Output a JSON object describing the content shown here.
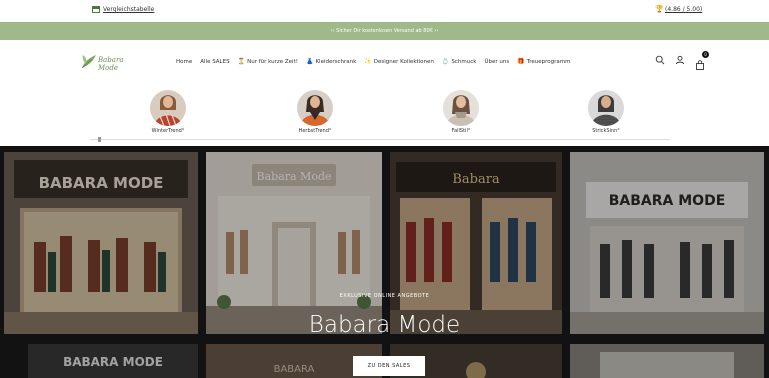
{
  "topbar": {
    "compare_label": "Vergleichstabelle",
    "rating": "(4.86 / 5.00)"
  },
  "banner": {
    "text": "›› Sicher Dir kostenlosen Versand ab 80€ ››"
  },
  "logo": {
    "text": "Babara Mode"
  },
  "nav": {
    "items": [
      {
        "label": "Home",
        "icon": ""
      },
      {
        "label": "Alle SALES",
        "icon": ""
      },
      {
        "label": "Nur für kurze Zeit!",
        "icon": "⏳"
      },
      {
        "label": "Kleiderschrank",
        "icon": "👗"
      },
      {
        "label": "Designer Kollektionen",
        "icon": "✨"
      },
      {
        "label": "Schmuck",
        "icon": "💍"
      },
      {
        "label": "Über uns",
        "icon": ""
      },
      {
        "label": "Treueprogramm",
        "icon": "🎁"
      }
    ],
    "cart_count": "0"
  },
  "categories": [
    {
      "label": "WinterTrend°"
    },
    {
      "label": "HerbstTrend°"
    },
    {
      "label": "FallStil°"
    },
    {
      "label": "StrickSinn°"
    }
  ],
  "hero": {
    "tile_texts": [
      "BABARA MODE",
      "Babara Mode",
      "Babara",
      "BABARA MODE",
      "BABARA MODE",
      "BABARA"
    ],
    "kicker": "EXKLUSIVE ONLINE ANGEBOTE",
    "title": "Babara Mode",
    "cta": "ZU DEN SALES"
  },
  "colors": {
    "banner": "#9fb98b",
    "brand_green": "#6c8f58",
    "hero_bg": "#1b1b1b"
  }
}
